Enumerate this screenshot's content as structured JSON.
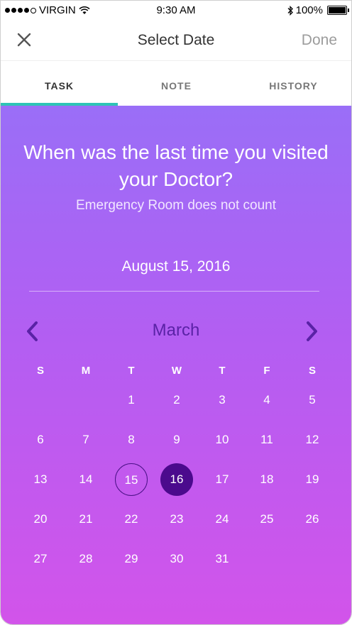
{
  "status_bar": {
    "carrier": "VIRGIN",
    "time": "9:30 AM",
    "battery": "100%"
  },
  "nav": {
    "title": "Select Date",
    "done_label": "Done"
  },
  "tabs": [
    {
      "label": "TASK",
      "active": true
    },
    {
      "label": "NOTE",
      "active": false
    },
    {
      "label": "HISTORY",
      "active": false
    }
  ],
  "question": {
    "title": "When was the last time you visited your Doctor?",
    "subtitle": "Emergency Room does not count"
  },
  "selected_date": "August 15, 2016",
  "calendar": {
    "month": "March",
    "weekdays": [
      "S",
      "M",
      "T",
      "W",
      "T",
      "F",
      "S"
    ],
    "days": [
      "1",
      "2",
      "3",
      "4",
      "5",
      "6",
      "7",
      "8",
      "9",
      "10",
      "11",
      "12",
      "13",
      "14",
      "15",
      "16",
      "17",
      "18",
      "19",
      "20",
      "21",
      "22",
      "23",
      "24",
      "25",
      "26",
      "27",
      "28",
      "29",
      "30",
      "31"
    ],
    "first_weekday_index": 2,
    "outlined_day": "15",
    "selected_day": "16"
  },
  "colors": {
    "accent": "#2ec4b6",
    "selected_day": "#4b0a8d",
    "month_label": "#5a22a6"
  }
}
